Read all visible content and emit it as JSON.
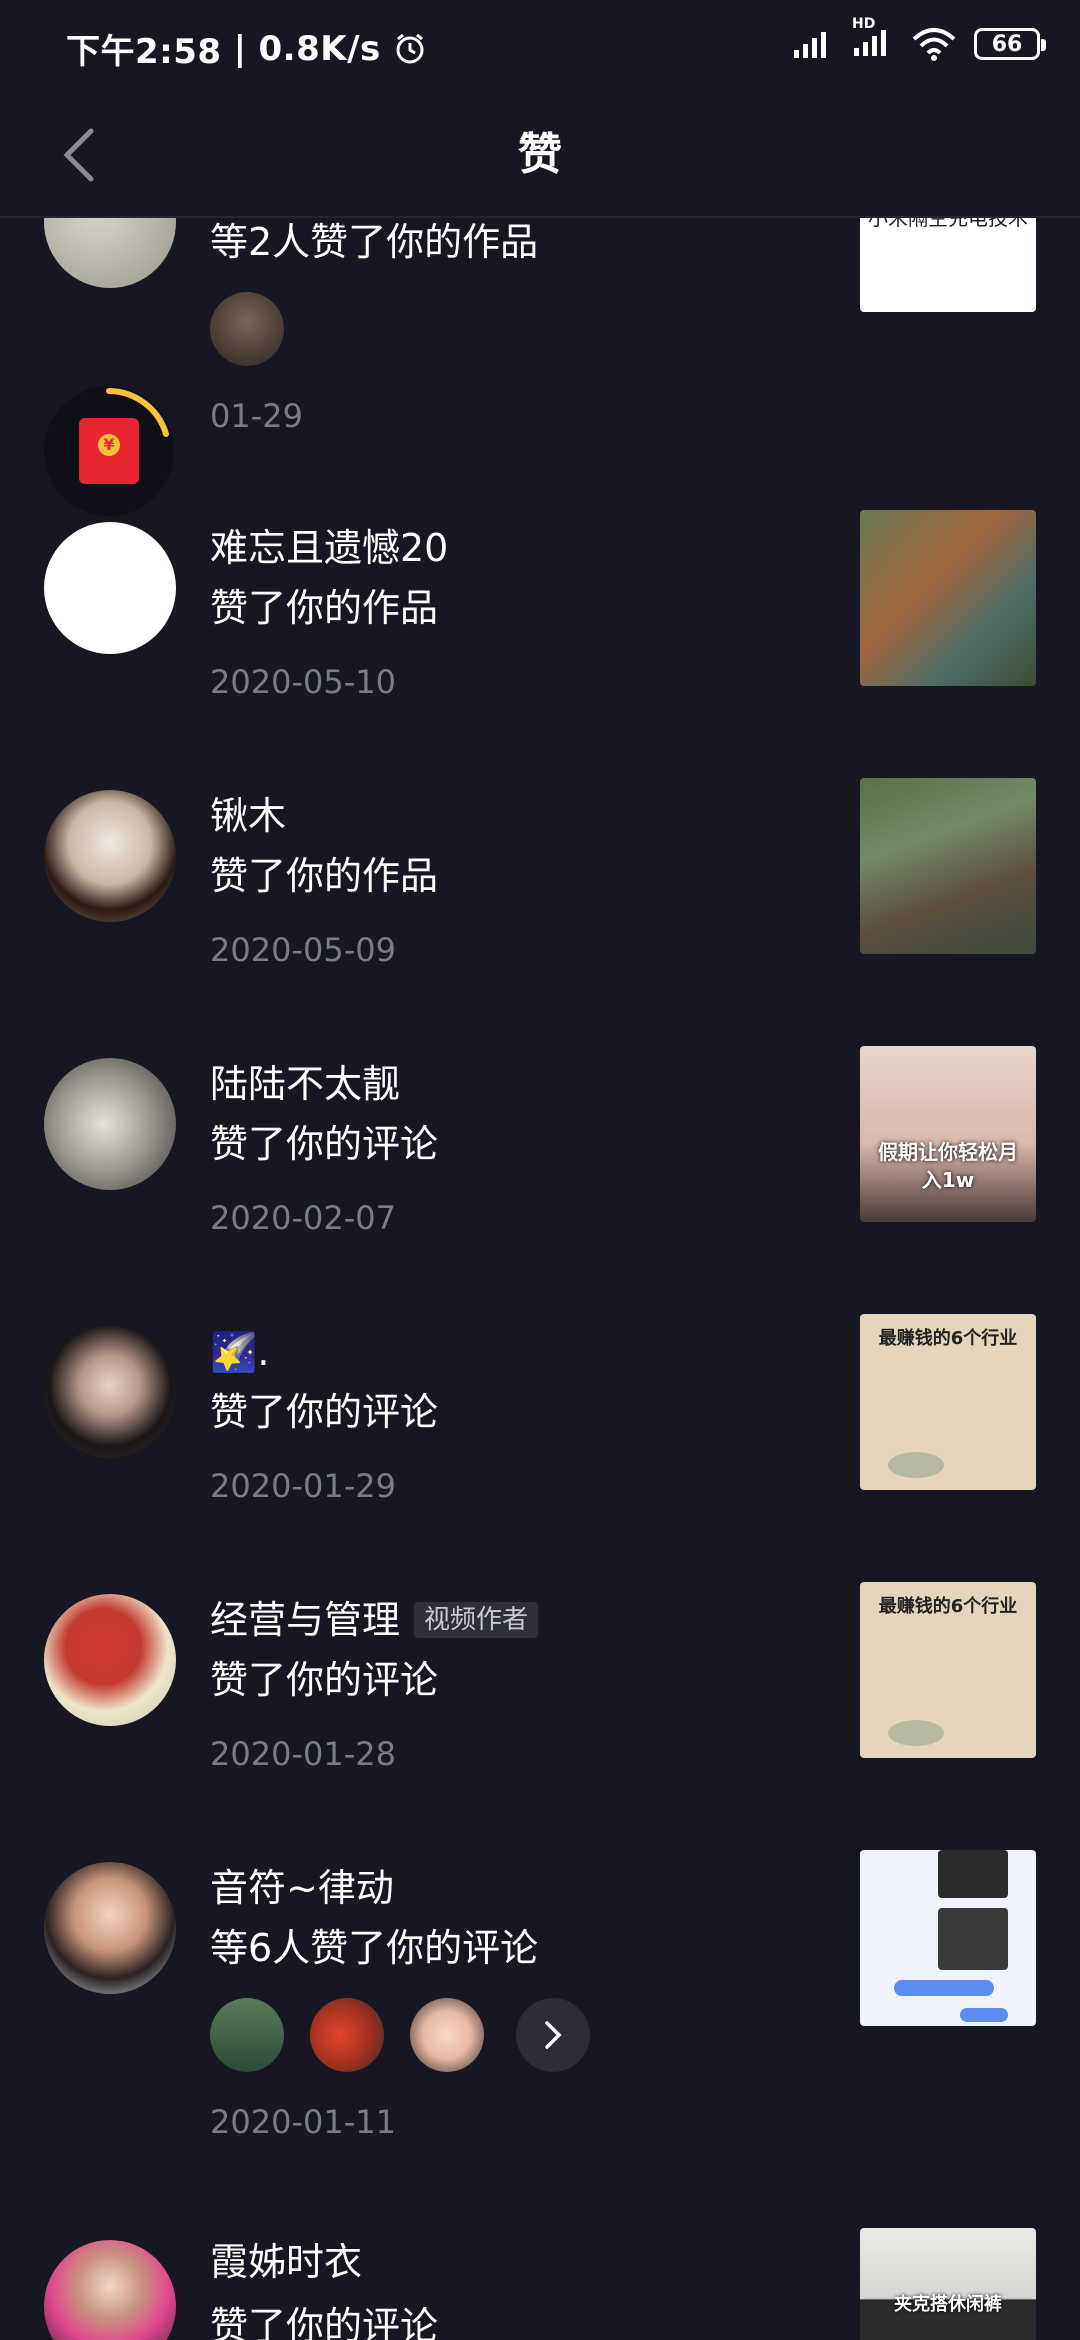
{
  "status_bar": {
    "time": "下午2:58",
    "speed": "0.8K/s",
    "battery": "66",
    "hd_label": "HD"
  },
  "header": {
    "title": "赞"
  },
  "items": [
    {
      "name": "",
      "action": "等2人赞了你的作品",
      "date": "01-29",
      "thumb_text": "小米隔空充电技术"
    },
    {
      "name": "难忘且遗憾20",
      "action": "赞了你的作品",
      "date": "2020-05-10"
    },
    {
      "name": "锹木",
      "action": "赞了你的作品",
      "date": "2020-05-09"
    },
    {
      "name": "陆陆不太靓",
      "action": "赞了你的评论",
      "date": "2020-02-07",
      "thumb_text": "假期让你轻松月入1w"
    },
    {
      "name": "🌠.",
      "action": "赞了你的评论",
      "date": "2020-01-29",
      "thumb_text": "最赚钱的6个行业"
    },
    {
      "name": "经营与管理",
      "badge": "视频作者",
      "action": "赞了你的评论",
      "date": "2020-01-28",
      "thumb_text": "最赚钱的6个行业"
    },
    {
      "name": "音符~律动",
      "action": "等6人赞了你的评论",
      "date": "2020-01-11"
    },
    {
      "name": "霞姊时衣",
      "action": "赞了你的评论",
      "date": "",
      "thumb_text": "夹克搭休闲裤"
    }
  ],
  "colors": {
    "background": "#161722",
    "secondary_text": "#7b7c87",
    "red_packet": "#e8262f",
    "progress": "#f7c23b"
  }
}
